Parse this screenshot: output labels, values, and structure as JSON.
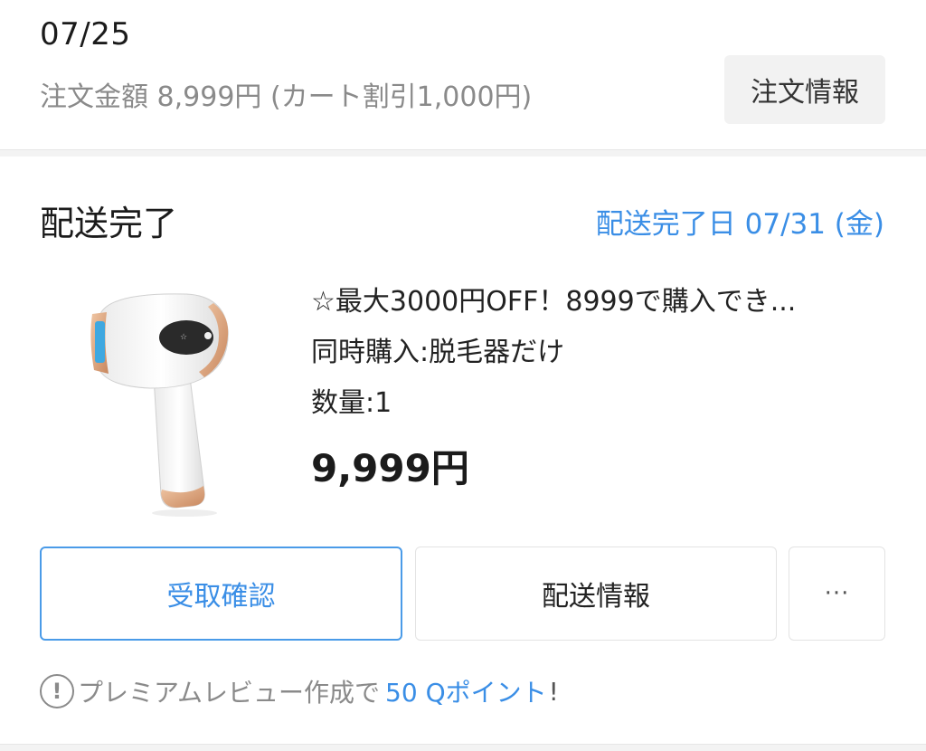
{
  "order": {
    "date": "07/25",
    "amount_text": "注文金額 8,999円 (カート割引1,000円)",
    "info_button_label": "注文情報"
  },
  "shipment": {
    "status": "配送完了",
    "delivery_date_text": "配送完了日 07/31 (金)"
  },
  "product": {
    "image_icon": "ipl-hair-removal-device-image",
    "title": "☆最大3000円OFF！8999で購入でき...",
    "option": "同時購入:脱毛器だけ",
    "quantity": "数量:1",
    "price": "9,999円"
  },
  "actions": {
    "confirm_label": "受取確認",
    "shipping_info_label": "配送情報",
    "more_label": "···"
  },
  "review_note": {
    "icon": "info-icon",
    "icon_glyph": "!",
    "text": "プレミアムレビュー作成で",
    "points": "50 Qポイント",
    "suffix": "!"
  },
  "colors": {
    "accent": "#3a8ee6",
    "muted_text": "#8a8a8a",
    "button_bg": "#f2f2f2",
    "product_copper": "#d9a07a",
    "product_window": "#3fa8e0"
  }
}
